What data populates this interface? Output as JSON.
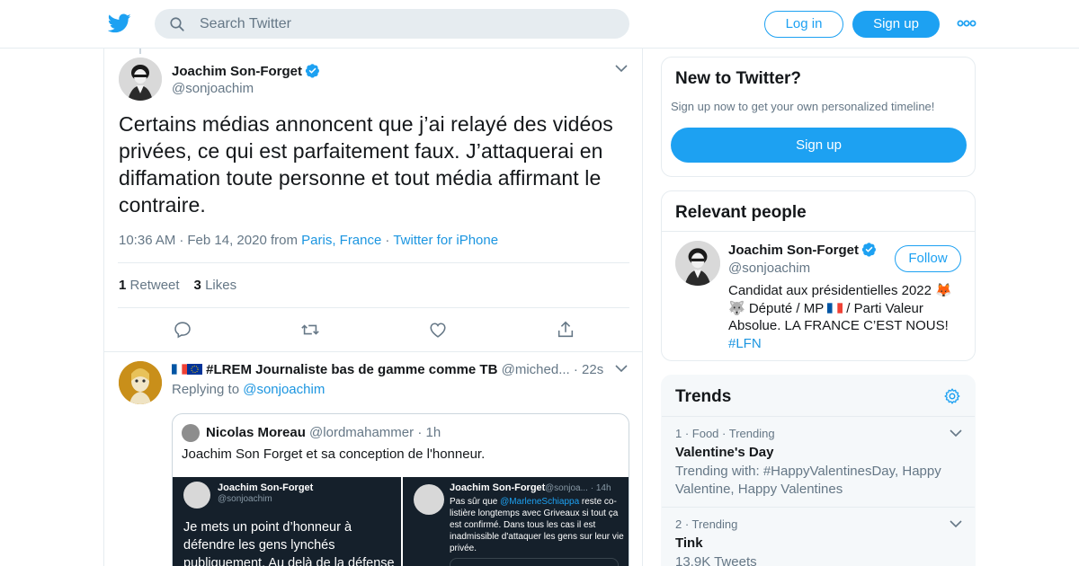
{
  "header": {
    "search_placeholder": "Search Twitter",
    "login_label": "Log in",
    "signup_label": "Sign up"
  },
  "tweet": {
    "author_name": "Joachim Son-Forget",
    "author_handle": "@sonjoachim",
    "text": "Certains médias annoncent que j’ai relayé des vidéos privées, ce qui est parfaitement faux. J’attaquerai en diffamation toute personne et tout média affirmant le contraire.",
    "time": "10:36 AM",
    "date_from": "Feb 14, 2020 from",
    "location": "Paris, France",
    "source": "Twitter for iPhone",
    "retweets_count": "1",
    "retweets_label": "Retweet",
    "likes_count": "3",
    "likes_label": "Likes"
  },
  "reply": {
    "name": "#LREM Journaliste bas de gamme comme TB",
    "handle": "@miched...",
    "time": "22s",
    "replying_prefix": "Replying to",
    "replying_to": "@sonjoachim",
    "quote": {
      "name": "Nicolas Moreau",
      "handle": "@lordmahammer",
      "time": "1h",
      "text": "Joachim Son Forget et sa conception de l'honneur.",
      "image1": {
        "name": "Joachim Son-Forget",
        "handle": "@sonjoachim",
        "text": "Je mets un point d’honneur à défendre les gens lynchés publiquement. Au delà de la défense de la présomption"
      },
      "image2": {
        "name": "Joachim Son-Forget",
        "handle": "@sonjoa... · 14h",
        "text_before": "Pas sûr que ",
        "mention": "@MarleneSchiappa",
        "text_after": " reste co-listière longtemps avec Griveaux si tout ça est confirmé. Dans tous les cas il est inadmissible d'attaquer les gens sur leur vie privée."
      }
    }
  },
  "sidebar": {
    "new_title": "New to Twitter?",
    "new_subtitle": "Sign up now to get your own personalized timeline!",
    "new_signup_label": "Sign up",
    "people_title": "Relevant people",
    "person": {
      "name": "Joachim Son-Forget",
      "handle": "@sonjoachim",
      "follow_label": "Follow",
      "bio_line1": "Candidat aux présidentielles 2022 🦊",
      "bio_line2a": "🐺 Député / MP ",
      "bio_line2b": " / Parti Valeur",
      "bio_line3": "Absolue. LA FRANCE C’EST NOUS!",
      "bio_hashtag": "#LFN"
    },
    "trends_title": "Trends",
    "trends": [
      {
        "meta": "1 · Food · Trending",
        "name": "Valentine's Day",
        "sub": "Trending with: #HappyValentinesDay, Happy Valentine, Happy Valentines"
      },
      {
        "meta": "2 · Trending",
        "name": "Tink",
        "sub": "13.9K Tweets"
      }
    ]
  },
  "colors": {
    "brand": "#1da1f2",
    "link": "#1b95e0",
    "secondary_text": "#657786",
    "border": "#e6ecf0"
  }
}
